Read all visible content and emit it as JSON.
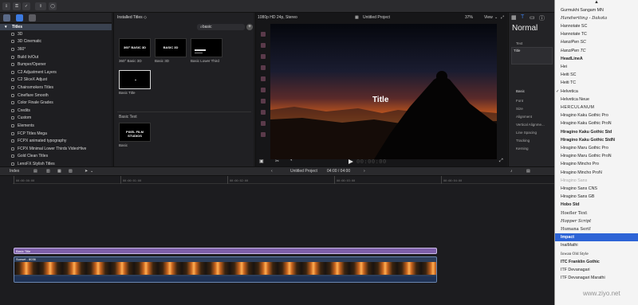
{
  "toolbar": {
    "buttons": [
      "",
      "",
      "",
      "",
      ""
    ]
  },
  "sidebar": {
    "header": "Titles",
    "items": [
      "3D",
      "3D Cinematic",
      "360°",
      "Build In/Out",
      "Bumper/Opener",
      "C2 Adjustment Layers",
      "C2 SliceX Adjust",
      "Chainsmokers Titles",
      "Cineflare Smooth",
      "Color Finale Grades",
      "Credits",
      "Custom",
      "Elements",
      "FCP Titles Mega",
      "FCPX animated typography",
      "FCPX Minimal Lower Thirds VideoHive",
      "Gold Clean Titles",
      "LenoFX Stylish Titles"
    ]
  },
  "browser": {
    "title": "Installed Titles ◇",
    "search_value": "basic",
    "row1": [
      {
        "thumb_text": "360° BASIC 3D",
        "label": "360° Basic 3D"
      },
      {
        "thumb_text": "BASIC 3D",
        "label": "Basic 3D"
      },
      {
        "thumb_text": "",
        "label": "Basic Lower Third"
      }
    ],
    "basic_title_label": "Basic Title",
    "section_label": "Basic Text",
    "basic_text_thumb": "PIXEL FILM STUDIOS",
    "basic_text_label": "Basic"
  },
  "viewer": {
    "format": "1080p HD 24p, Stereo",
    "project": "Untitled Project",
    "zoom": "37%",
    "view": "View",
    "overlay_title": "Title",
    "timecode": "00:00:00"
  },
  "inspector": {
    "heading": "Normal",
    "text_label": "Text",
    "text_value": "Title",
    "basic_label": "Basic",
    "props": [
      "Font",
      "Size",
      "Alignment",
      "Vertical Alignme...",
      "Line Spacing",
      "Tracking",
      "Kerning"
    ]
  },
  "timeline": {
    "index_label": "Index",
    "project_label": "Untitled Project",
    "duration": "04:00 / 04:00",
    "ruler_ticks": [
      "00:00:00:00",
      "00:00:01:00",
      "00:00:02:00",
      "00:00:03:00",
      "00:00:04:00"
    ],
    "title_clip": "Basic Title",
    "video_clip": "Sunset - 8036"
  },
  "font_menu": {
    "items": [
      "Gurmukhi Sangam MN",
      "Handwriting - Dakota",
      "Hannotate SC",
      "Hannotate TC",
      "HanziPen SC",
      "HanziPen TC",
      "HeadLineA",
      "Hei",
      "Heiti SC",
      "Heiti TC",
      "Helvetica",
      "Helvetica Neue",
      "HERCULANUM",
      "Hiragino Kaku Gothic Pro",
      "Hiragino Kaku Gothic ProN",
      "Hiragino Kaku Gothic Std",
      "Hiragino Kaku Gothic StdN",
      "Hiragino Maru Gothic Pro",
      "Hiragino Maru Gothic ProN",
      "Hiragino Mincho Pro",
      "Hiragino Mincho ProN",
      "Hiragino Sans",
      "Hiragino Sans CNS",
      "Hiragino Sans GB",
      "Hobo Std",
      "Hoefler Text",
      "Hopper Script",
      "Humana Serif",
      "Impact",
      "InaiMathi",
      "Iowan Old Style",
      "ITC Franklin Gothic",
      "ITF Devanagari",
      "ITF Devanagari Marathi"
    ],
    "checked": "Helvetica",
    "selected": "Impact"
  },
  "watermark": "www.ziyo.net",
  "colors": {
    "accent": "#2d64d6",
    "title_clip": "#7c5ea8",
    "video_clip": "#2c3e5a"
  }
}
